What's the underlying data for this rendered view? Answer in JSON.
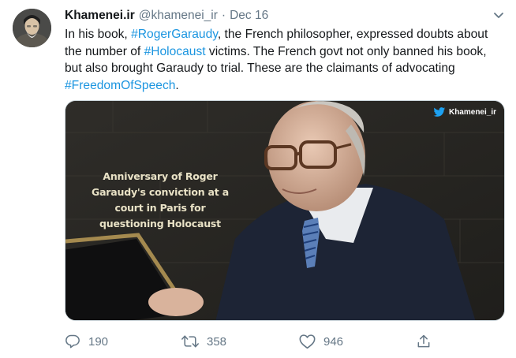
{
  "tweet": {
    "author_name": "Khamenei.ir",
    "handle": "@khamenei_ir",
    "separator": "·",
    "date": "Dec 16",
    "text": [
      {
        "type": "text",
        "value": "In his book, "
      },
      {
        "type": "hashtag",
        "value": "#RogerGaraudy"
      },
      {
        "type": "text",
        "value": ", the French philosopher, expressed doubts about the number of "
      },
      {
        "type": "hashtag",
        "value": "#Holocaust"
      },
      {
        "type": "text",
        "value": " victims. The French govt not only banned his book, but also brought Garaudy to trial. These are the claimants of advocating "
      },
      {
        "type": "hashtag",
        "value": "#FreedomOfSpeech"
      },
      {
        "type": "text",
        "value": "."
      }
    ],
    "media": {
      "caption": "Anniversary of Roger Garaudy's conviction at a court in Paris for questioning Holocaust",
      "watermark": "Khamenei_ir"
    },
    "actions": {
      "replies": "190",
      "retweets": "358",
      "likes": "946"
    }
  },
  "colors": {
    "link": "#1b95e0",
    "secondary_text": "#657786",
    "twitter_blue": "#1da1f2"
  },
  "icons": [
    "more-chevron-icon",
    "reply-icon",
    "retweet-icon",
    "like-icon",
    "share-icon",
    "twitter-bird-icon"
  ]
}
